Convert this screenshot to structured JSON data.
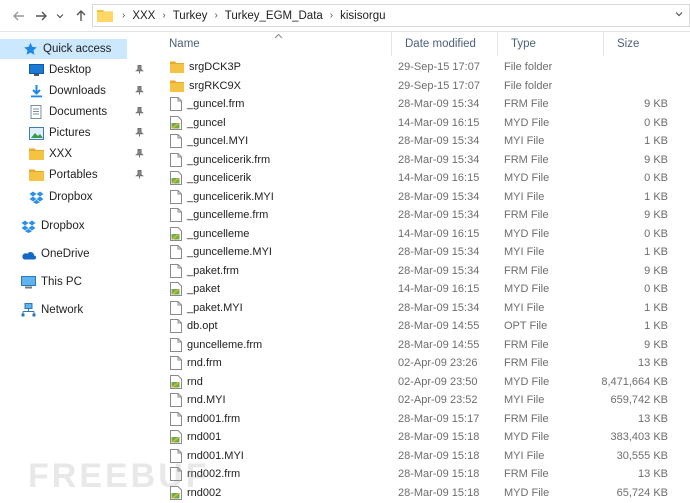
{
  "address_bar": {
    "crumbs": [
      "XXX",
      "Turkey",
      "Turkey_EGM_Data",
      "kisisorgu"
    ]
  },
  "sidebar": {
    "items": [
      {
        "label": "Quick access",
        "icon": "star-icon",
        "pinned": false,
        "active": true
      },
      {
        "label": "Desktop",
        "icon": "desktop-icon",
        "pinned": true
      },
      {
        "label": "Downloads",
        "icon": "download-icon",
        "pinned": true
      },
      {
        "label": "Documents",
        "icon": "documents-icon",
        "pinned": true
      },
      {
        "label": "Pictures",
        "icon": "pictures-icon",
        "pinned": true
      },
      {
        "label": "XXX",
        "icon": "folder-icon",
        "pinned": true
      },
      {
        "label": "Portables",
        "icon": "folder-icon",
        "pinned": true
      },
      {
        "label": "Dropbox",
        "icon": "dropbox-icon",
        "pinned": false
      },
      {
        "label": "Dropbox",
        "icon": "dropbox-icon",
        "pinned": false
      },
      {
        "label": "OneDrive",
        "icon": "onedrive-icon",
        "pinned": false
      },
      {
        "label": "This PC",
        "icon": "computer-icon",
        "pinned": false
      },
      {
        "label": "Network",
        "icon": "network-icon",
        "pinned": false
      }
    ]
  },
  "columns": {
    "name": "Name",
    "date": "Date modified",
    "type": "Type",
    "size": "Size"
  },
  "files": [
    {
      "name": "srgDCK3P",
      "date": "29-Sep-15 17:07",
      "type": "File folder",
      "size": "",
      "icon": "folder"
    },
    {
      "name": "srgRKC9X",
      "date": "29-Sep-15 17:07",
      "type": "File folder",
      "size": "",
      "icon": "folder"
    },
    {
      "name": "_guncel.frm",
      "date": "28-Mar-09 15:34",
      "type": "FRM File",
      "size": "9 KB",
      "icon": "file"
    },
    {
      "name": "_guncel",
      "date": "14-Mar-09 16:15",
      "type": "MYD File",
      "size": "0 KB",
      "icon": "myd"
    },
    {
      "name": "_guncel.MYI",
      "date": "28-Mar-09 15:34",
      "type": "MYI File",
      "size": "1 KB",
      "icon": "file"
    },
    {
      "name": "_guncelicerik.frm",
      "date": "28-Mar-09 15:34",
      "type": "FRM File",
      "size": "9 KB",
      "icon": "file"
    },
    {
      "name": "_guncelicerik",
      "date": "14-Mar-09 16:15",
      "type": "MYD File",
      "size": "0 KB",
      "icon": "myd"
    },
    {
      "name": "_guncelicerik.MYI",
      "date": "28-Mar-09 15:34",
      "type": "MYI File",
      "size": "1 KB",
      "icon": "file"
    },
    {
      "name": "_guncelleme.frm",
      "date": "28-Mar-09 15:34",
      "type": "FRM File",
      "size": "9 KB",
      "icon": "file"
    },
    {
      "name": "_guncelleme",
      "date": "14-Mar-09 16:15",
      "type": "MYD File",
      "size": "0 KB",
      "icon": "myd"
    },
    {
      "name": "_guncelleme.MYI",
      "date": "28-Mar-09 15:34",
      "type": "MYI File",
      "size": "1 KB",
      "icon": "file"
    },
    {
      "name": "_paket.frm",
      "date": "28-Mar-09 15:34",
      "type": "FRM File",
      "size": "9 KB",
      "icon": "file"
    },
    {
      "name": "_paket",
      "date": "14-Mar-09 16:15",
      "type": "MYD File",
      "size": "0 KB",
      "icon": "myd"
    },
    {
      "name": "_paket.MYI",
      "date": "28-Mar-09 15:34",
      "type": "MYI File",
      "size": "1 KB",
      "icon": "file"
    },
    {
      "name": "db.opt",
      "date": "28-Mar-09 14:55",
      "type": "OPT File",
      "size": "1 KB",
      "icon": "file"
    },
    {
      "name": "guncelleme.frm",
      "date": "28-Mar-09 14:55",
      "type": "FRM File",
      "size": "9 KB",
      "icon": "file"
    },
    {
      "name": "rnd.frm",
      "date": "02-Apr-09 23:26",
      "type": "FRM File",
      "size": "13 KB",
      "icon": "file"
    },
    {
      "name": "rnd",
      "date": "02-Apr-09 23:50",
      "type": "MYD File",
      "size": "8,471,664 KB",
      "icon": "myd"
    },
    {
      "name": "rnd.MYI",
      "date": "02-Apr-09 23:52",
      "type": "MYI File",
      "size": "659,742 KB",
      "icon": "file"
    },
    {
      "name": "rnd001.frm",
      "date": "28-Mar-09 15:17",
      "type": "FRM File",
      "size": "13 KB",
      "icon": "file"
    },
    {
      "name": "rnd001",
      "date": "28-Mar-09 15:18",
      "type": "MYD File",
      "size": "383,403 KB",
      "icon": "myd"
    },
    {
      "name": "rnd001.MYI",
      "date": "28-Mar-09 15:18",
      "type": "MYI File",
      "size": "30,555 KB",
      "icon": "file"
    },
    {
      "name": "rnd002.frm",
      "date": "28-Mar-09 15:18",
      "type": "FRM File",
      "size": "13 KB",
      "icon": "file"
    },
    {
      "name": "rnd002",
      "date": "28-Mar-09 15:18",
      "type": "MYD File",
      "size": "65,724 KB",
      "icon": "myd"
    }
  ],
  "watermark": "FREEBUF",
  "colors": {
    "selection": "#cce8ff",
    "folder": "#f5c343",
    "header_text": "#4c607a"
  }
}
